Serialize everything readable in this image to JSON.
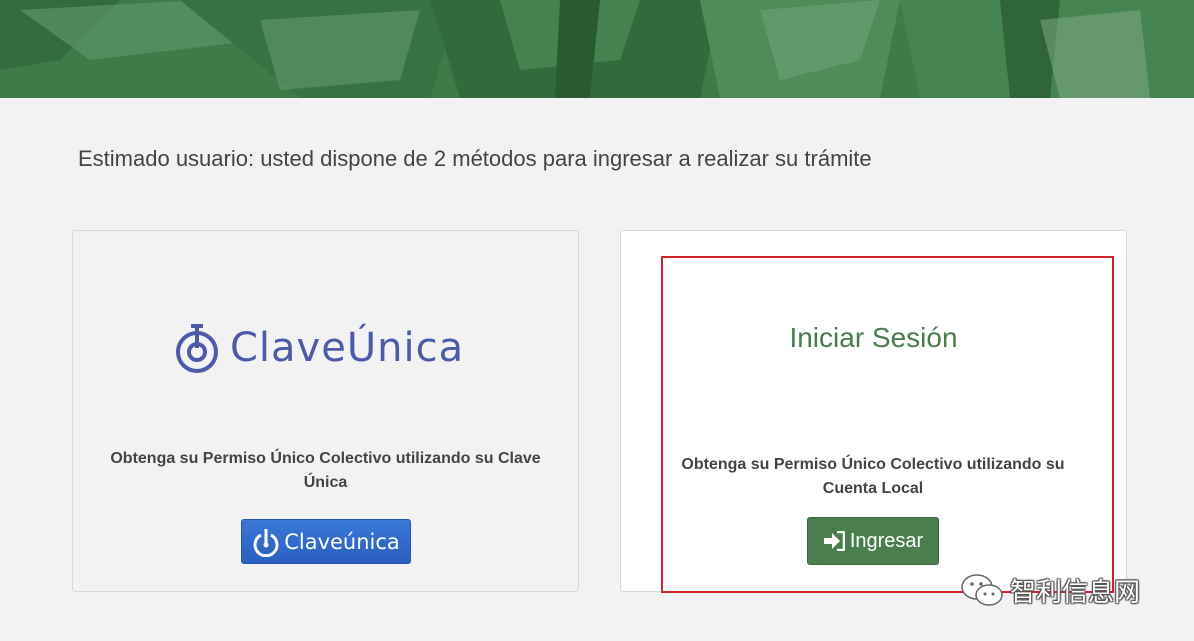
{
  "intro": {
    "text": "Estimado usuario: usted dispone de 2 métodos para ingresar a realizar su trámite"
  },
  "clave_unica_card": {
    "logo_text": "ClaveÚnica",
    "description": "Obtenga su Permiso Único Colectivo utilizando su Clave Única",
    "button_label": "Claveúnica",
    "button_icon": "clave-unica-power-icon"
  },
  "local_login_card": {
    "title": "Iniciar Sesión",
    "description": "Obtenga su Permiso Único Colectivo utilizando su Cuenta Local",
    "button_label": "Ingresar",
    "button_icon": "sign-in-icon"
  },
  "watermark": {
    "text": "智利信息网"
  },
  "colors": {
    "hero_green": "#3d7a48",
    "clave_blue": "#4c5aa8",
    "button_blue": "#2a5fc0",
    "login_green": "#4a7f4d",
    "highlight_red": "#d2232a",
    "background": "#f2f2f2"
  }
}
